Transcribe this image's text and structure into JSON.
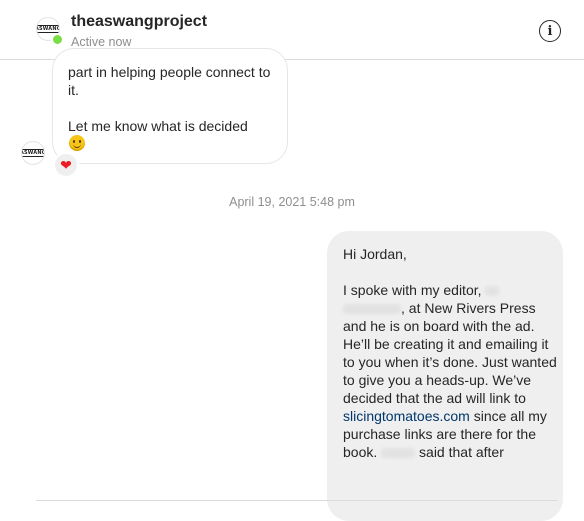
{
  "header": {
    "username": "theaswangproject",
    "status": "Active now",
    "avatar_logo": "ASWANG",
    "info_icon": "info-icon"
  },
  "incoming": {
    "line_partial": "part in helping people connect to it.",
    "line_last": "Let me know what is decided",
    "reaction": "❤"
  },
  "timestamp": "April 19, 2021 5:48 pm",
  "outgoing": {
    "greeting": "Hi Jordan,",
    "p1": "I spoke with my editor,",
    "p2": ", at New Rivers Press and he is on board with the ad. He’ll be creating it and emailing it to you when it’s done. Just wanted to give you a heads-up. We’ve decided that the ad will link to",
    "link": "slicingtomatoes.com",
    "p3": "since all my purchase links are there for the book.",
    "p4": "said that after"
  }
}
